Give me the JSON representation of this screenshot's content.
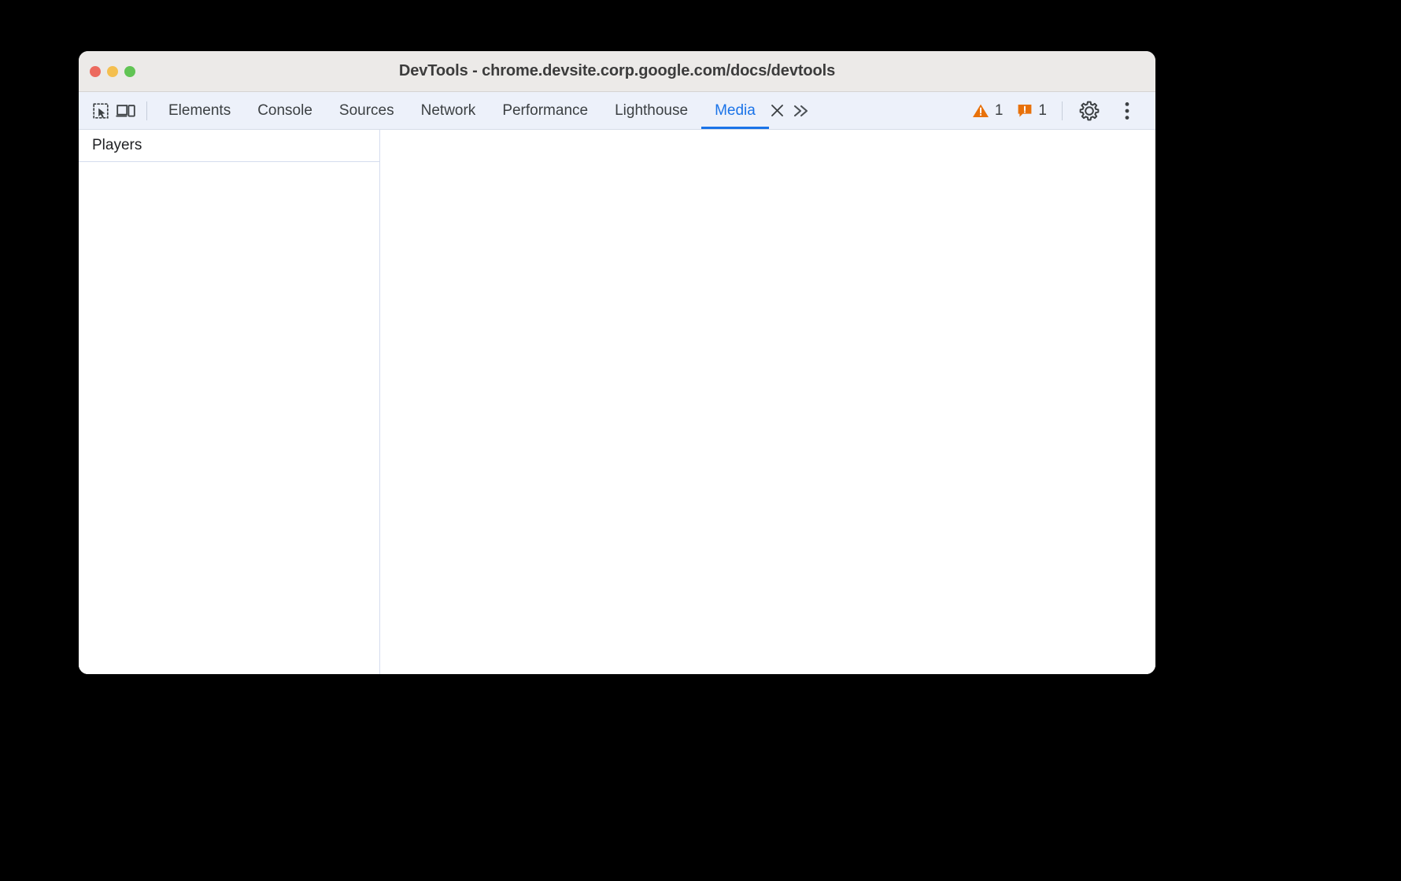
{
  "window": {
    "title": "DevTools - chrome.devsite.corp.google.com/docs/devtools",
    "traffic_lights": {
      "close": "close-window",
      "minimize": "minimize-window",
      "maximize": "maximize-window"
    }
  },
  "toolbar": {
    "inspect_icon": "inspect-element-icon",
    "device_toggle_icon": "device-toolbar-icon",
    "tabs": [
      {
        "label": "Elements",
        "active": false
      },
      {
        "label": "Console",
        "active": false
      },
      {
        "label": "Sources",
        "active": false
      },
      {
        "label": "Network",
        "active": false
      },
      {
        "label": "Performance",
        "active": false
      },
      {
        "label": "Lighthouse",
        "active": false
      },
      {
        "label": "Media",
        "active": true
      }
    ],
    "close_tab_icon": "close-icon",
    "more_tabs_icon": "chevron-double-right-icon",
    "warnings": {
      "icon": "warning-triangle-icon",
      "count": "1",
      "color": "#E8710A"
    },
    "errors": {
      "icon": "error-badge-icon",
      "count": "1",
      "color": "#E8710A"
    },
    "settings_icon": "gear-icon",
    "more_options_icon": "vertical-dots-icon"
  },
  "media_panel": {
    "sidebar": {
      "header": "Players",
      "items": []
    },
    "detail": {
      "content": ""
    }
  },
  "colors": {
    "accent": "#1A73E8",
    "toolbar_bg": "#EDF1FA",
    "titlebar_bg": "#ECEAE8",
    "panel_bg": "#FFFFFF",
    "page_bg": "#000000"
  }
}
